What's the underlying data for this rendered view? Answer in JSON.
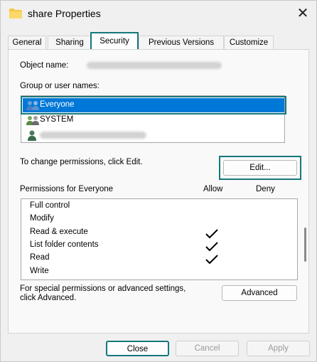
{
  "window": {
    "title": "share Properties",
    "close_glyph": "✕"
  },
  "tabs": [
    {
      "label": "General"
    },
    {
      "label": "Sharing"
    },
    {
      "label": "Security",
      "active": true
    },
    {
      "label": "Previous Versions"
    },
    {
      "label": "Customize"
    }
  ],
  "security": {
    "object_name_label": "Object name:",
    "group_label": "Group or user names:",
    "users": [
      {
        "name": "Everyone",
        "icon": "group-users-icon",
        "selected": true
      },
      {
        "name": "SYSTEM",
        "icon": "system-users-icon",
        "selected": false
      },
      {
        "name": "",
        "icon": "user-icon",
        "selected": false
      }
    ],
    "change_hint": "To change permissions, click Edit.",
    "edit_button": "Edit...",
    "permissions_for": "Permissions for Everyone",
    "allow_header": "Allow",
    "deny_header": "Deny",
    "permissions": [
      {
        "name": "Full control",
        "allow": false,
        "deny": false
      },
      {
        "name": "Modify",
        "allow": false,
        "deny": false
      },
      {
        "name": "Read & execute",
        "allow": true,
        "deny": false
      },
      {
        "name": "List folder contents",
        "allow": true,
        "deny": false
      },
      {
        "name": "Read",
        "allow": true,
        "deny": false
      },
      {
        "name": "Write",
        "allow": false,
        "deny": false
      }
    ],
    "advanced_hint_line1": "For special permissions or advanced settings,",
    "advanced_hint_line2": "click Advanced.",
    "advanced_button": "Advanced"
  },
  "footer": {
    "close": "Close",
    "cancel": "Cancel",
    "apply": "Apply"
  },
  "colors": {
    "accent_highlight": "#17777c",
    "selection": "#0078d7",
    "folder": "#f5c542"
  }
}
